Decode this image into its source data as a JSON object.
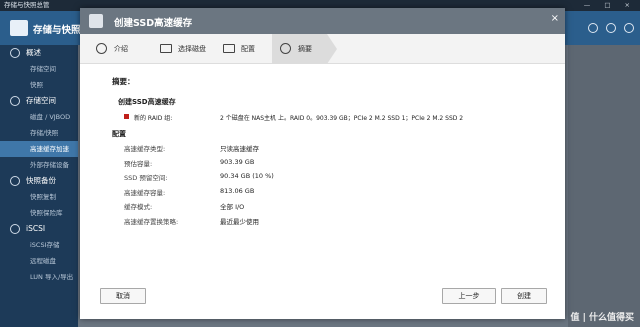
{
  "window": {
    "title": "存储与快照总管",
    "controls": "— □ ×"
  },
  "app": {
    "title": "存储与快照"
  },
  "sidebar": {
    "sections": [
      {
        "label": "概述",
        "icon": "overview-icon",
        "items": [
          "存储空间",
          "快照"
        ]
      },
      {
        "label": "存储空间",
        "icon": "storage-icon",
        "items": [
          "磁盘 / VJBOD",
          "存储/快照",
          "高速缓存加速",
          "外部存储设备"
        ]
      },
      {
        "label": "快照备份",
        "icon": "snapshot-backup-icon",
        "items": [
          "快照复制",
          "快照保险库"
        ]
      },
      {
        "label": "iSCSI",
        "icon": "iscsi-icon",
        "items": [
          "iSCSI存储",
          "远程磁盘",
          "LUN 导入/导出"
        ]
      }
    ],
    "active_item": "高速缓存加速"
  },
  "dialog": {
    "title": "创建SSD高速缓存",
    "close": "×",
    "steps": [
      {
        "label": "介绍",
        "icon": "info-icon"
      },
      {
        "label": "选择磁盘",
        "icon": "disk-icon"
      },
      {
        "label": "配置",
        "icon": "config-icon"
      },
      {
        "label": "摘要",
        "icon": "check-icon"
      }
    ],
    "active_step": "摘要",
    "summary_title": "摘要：",
    "create_section": "创建SSD高速缓存",
    "raid": {
      "label": "新的 RAID 组:",
      "value": "2 个磁盘在 NAS主机 上。RAID 0。903.39 GB；PCIe 2 M.2 SSD 1；PCIe 2 M.2 SSD 2"
    },
    "config_section": "配置",
    "config": [
      {
        "key": "高速缓存类型:",
        "value": "只读高速缓存"
      },
      {
        "key": "预估容量:",
        "value": "903.39 GB"
      },
      {
        "key": "SSD 预留空间:",
        "value": "90.34 GB (10 %)"
      },
      {
        "key": "高速缓存容量:",
        "value": "813.06 GB"
      },
      {
        "key": "缓存模式:",
        "value": "全部 I/O"
      },
      {
        "key": "高速缓存置换策略:",
        "value": "最近最少使用"
      }
    ],
    "buttons": {
      "cancel": "取消",
      "back": "上一步",
      "create": "创建"
    }
  },
  "watermark": "值 | 什么值得买"
}
